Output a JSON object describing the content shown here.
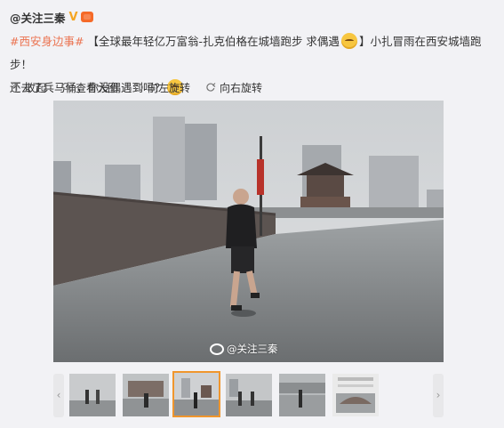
{
  "post": {
    "author": "@关注三秦",
    "verified_badge": "V",
    "topic": "#西安身边事#",
    "text_1": "【全球最年轻亿万富翁-扎克伯格在城墙跑步 求偶遇",
    "text_2": "】小扎冒雨在西安城墙跑步！",
    "text_3": "还去了兵马俑，你没偶遇到吗？"
  },
  "actions": [
    {
      "label": "收起",
      "icon": "collapse-icon"
    },
    {
      "label": "查看大图",
      "icon": "search-icon"
    },
    {
      "label": "向左旋转",
      "icon": "rotate-left-icon"
    },
    {
      "label": "向右旋转",
      "icon": "rotate-right-icon"
    }
  ],
  "image": {
    "watermark": "@关注三秦"
  },
  "colors": {
    "topic": "#eb7350",
    "accent_border": "#f0962d",
    "badge": "#f5a623"
  }
}
